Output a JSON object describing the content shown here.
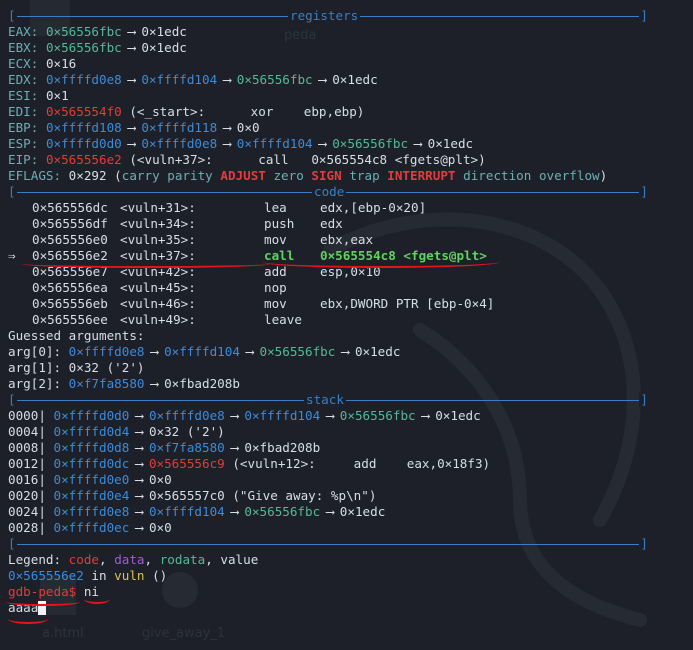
{
  "sections": {
    "registers": "registers",
    "code": "code",
    "stack": "stack"
  },
  "registers": [
    {
      "name": "EAX:",
      "a1": "0×56556fbc",
      "arrow1": "⟶",
      "v1": "0×1edc"
    },
    {
      "name": "EBX:",
      "a1": "0×56556fbc",
      "arrow1": "⟶",
      "v1": "0×1edc"
    },
    {
      "name": "ECX:",
      "v": "0×16"
    },
    {
      "name": "EDX:",
      "a1": "0×ffffd0e8",
      "arrow1": "⟶",
      "a2": "0×ffffd104",
      "arrow2": "⟶",
      "a3": "0×56556fbc",
      "arrow3": "⟶",
      "v1": "0×1edc"
    },
    {
      "name": "ESI:",
      "v": "0×1"
    },
    {
      "name": "EDI:",
      "a1": "0×565554f0",
      "rest": " (<_start>:      xor    ebp,ebp)"
    },
    {
      "name": "EBP:",
      "a1": "0×ffffd108",
      "arrow1": "⟶",
      "a2": "0×ffffd118",
      "arrow2": "⟶",
      "v1": "0×0"
    },
    {
      "name": "ESP:",
      "a1": "0×ffffd0d0",
      "arrow1": "⟶",
      "a2": "0×ffffd0e8",
      "arrow2": "⟶",
      "a3": "0×ffffd104",
      "arrow3": "⟶",
      "a4": "0×56556fbc",
      "arrow4": "⟶",
      "v1": "0×1edc"
    },
    {
      "name": "EIP:",
      "a1": "0×565556e2",
      "rest": " (<vuln+37>:      call   0×565554c8 <fgets@plt>)"
    }
  ],
  "eflags": {
    "name": "EFLAGS:",
    "value": " 0×292 (",
    "flags": [
      "carry",
      "parity",
      "ADJUST",
      "zero",
      "SIGN",
      "trap",
      "INTERRUPT",
      "direction",
      "overflow"
    ],
    "close": ")"
  },
  "code": [
    {
      "pointer": "",
      "addr": "0×565556dc",
      "sym": "<vuln+31>:",
      "op": "lea",
      "args": "edx,[ebp-0×20]"
    },
    {
      "pointer": "",
      "addr": "0×565556df",
      "sym": "<vuln+34>:",
      "op": "push",
      "args": "edx"
    },
    {
      "pointer": "",
      "addr": "0×565556e0",
      "sym": "<vuln+35>:",
      "op": "mov",
      "args": "ebx,eax"
    },
    {
      "pointer": "⇒",
      "addr": "0×565556e2",
      "sym": "<vuln+37>:",
      "op": "call",
      "args": "0×565554c8 <fgets@plt>"
    },
    {
      "pointer": "",
      "addr": "0×565556e7",
      "sym": "<vuln+42>:",
      "op": "add",
      "args": "esp,0×10"
    },
    {
      "pointer": "",
      "addr": "0×565556ea",
      "sym": "<vuln+45>:",
      "op": "nop",
      "args": ""
    },
    {
      "pointer": "",
      "addr": "0×565556eb",
      "sym": "<vuln+46>:",
      "op": "mov",
      "args": "ebx,DWORD PTR [ebp-0×4]"
    },
    {
      "pointer": "",
      "addr": "0×565556ee",
      "sym": "<vuln+49>:",
      "op": "leave",
      "args": ""
    }
  ],
  "guessed": {
    "title": "Guessed arguments:",
    "args": [
      {
        "label": "arg[0]: ",
        "parts": [
          "0×ffffd0e8",
          "⟶",
          "0×ffffd104",
          "⟶",
          "0×56556fbc",
          "⟶",
          "0×1edc"
        ]
      },
      {
        "label": "arg[1]: ",
        "parts": [
          "0×32 ('2')"
        ]
      },
      {
        "label": "arg[2]: ",
        "parts": [
          "0×f7fa8580",
          "⟶",
          "0×fbad208b"
        ]
      }
    ]
  },
  "stack": [
    {
      "off": "0000|",
      "addr": "0×ffffd0d0",
      "rest": [
        [
          "a",
          "0×ffffd0e8"
        ],
        [
          "a",
          "0×ffffd104"
        ],
        [
          "r",
          "0×56556fbc"
        ],
        [
          "v",
          "0×1edc"
        ]
      ]
    },
    {
      "off": "0004|",
      "addr": "0×ffffd0d4",
      "rest": [
        [
          "v",
          "0×32 ('2')"
        ]
      ]
    },
    {
      "off": "0008|",
      "addr": "0×ffffd0d8",
      "rest": [
        [
          "a",
          "0×f7fa8580"
        ],
        [
          "v",
          "0×fbad208b"
        ]
      ]
    },
    {
      "off": "0012|",
      "addr": "0×ffffd0dc",
      "rest": [
        [
          "c",
          "0×565556c9"
        ],
        [
          "t",
          " (<vuln+12>:     add    eax,0×18f3)"
        ]
      ]
    },
    {
      "off": "0016|",
      "addr": "0×ffffd0e0",
      "rest": [
        [
          "v",
          "0×0"
        ]
      ]
    },
    {
      "off": "0020|",
      "addr": "0×ffffd0e4",
      "rest": [
        [
          "v",
          "0×565557c0 (\"Give away: %p\\n\")"
        ]
      ]
    },
    {
      "off": "0024|",
      "addr": "0×ffffd0e8",
      "rest": [
        [
          "a",
          "0×ffffd104"
        ],
        [
          "r",
          "0×56556fbc"
        ],
        [
          "v",
          "0×1edc"
        ]
      ]
    },
    {
      "off": "0028|",
      "addr": "0×ffffd0ec",
      "rest": [
        [
          "v",
          "0×0"
        ]
      ]
    }
  ],
  "legend": {
    "label": "Legend: ",
    "code": "code",
    "data": "data",
    "rodata": "rodata",
    "value": "value",
    "sep": ", "
  },
  "location": {
    "addr": "0×565556e2",
    "in": " in ",
    "func": "vuln",
    "paren": " ()"
  },
  "prompt": {
    "text": "gdb-peda$",
    "command": " ni"
  },
  "input": {
    "text": "aaaa"
  },
  "background": {
    "labels": [
      "peda",
      "a.html",
      "give_away_1"
    ]
  },
  "colors": {
    "background": "#1d2028",
    "separator": "#3a7fc1",
    "register": "#6bb0b5",
    "stack_addr": "#3d8bd9",
    "code_addr": "#e23c3c",
    "data_addr": "#a05cd6",
    "rodata": "#57b79a",
    "current_instruction": "#5ed35e",
    "annotation_underline": "#e0161a"
  }
}
